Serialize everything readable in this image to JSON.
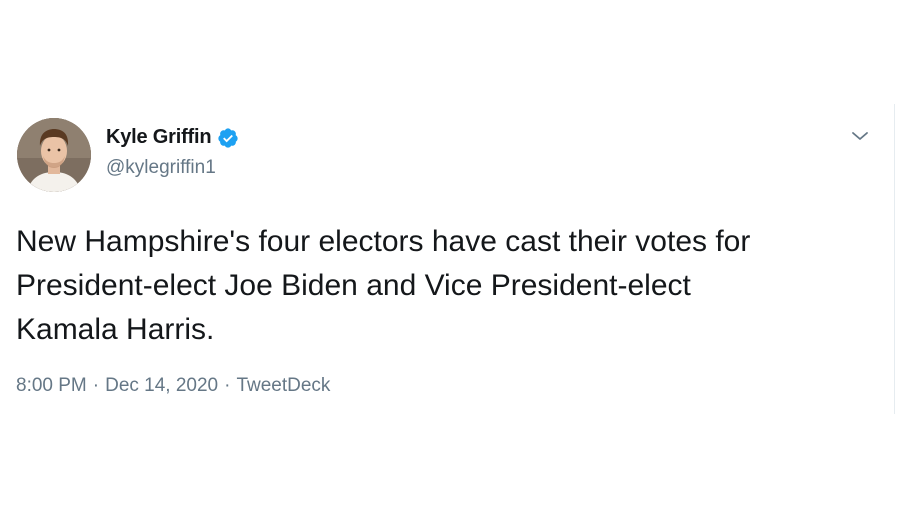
{
  "tweet": {
    "author": {
      "display_name": "Kyle Griffin",
      "handle": "@kylegriffin1",
      "verified": true
    },
    "text": "New Hampshire's four electors have cast their votes for\nPresident-elect Joe Biden and Vice President-elect\nKamala Harris.",
    "time": "8:00 PM",
    "date": "Dec 14, 2020",
    "source": "TweetDeck",
    "separator": "·"
  },
  "icons": {
    "verified": "verified-badge-icon",
    "menu": "chevron-down-icon"
  },
  "colors": {
    "text_primary": "#14171a",
    "text_secondary": "#657786",
    "verified_blue": "#1da1f2",
    "border": "#e6ecf0"
  }
}
